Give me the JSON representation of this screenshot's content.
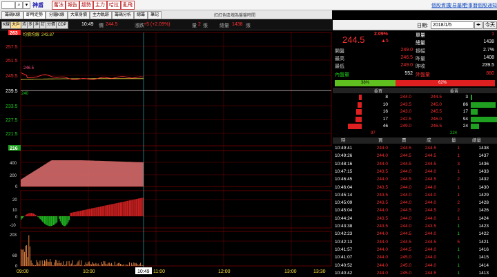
{
  "toolbar": {
    "stock_name": "神盾",
    "buttons": [
      "奮法",
      "報告",
      "趨勢",
      "主力",
      "哈拉",
      "亂飛"
    ],
    "links": [
      "個股資訊",
      "交易屬性",
      "行事曆",
      "個股通知"
    ]
  },
  "tabs": {
    "items": [
      "籌碼K線",
      "即時走勢",
      "分鐘K線",
      "大單身價",
      "主力軌跡",
      "籌碼分析",
      "總籌",
      "筆記"
    ],
    "active": 1,
    "notice": "紅紅色區塊為盤盤時間"
  },
  "kbar": {
    "buttons": [
      "K線",
      "大戶",
      "均",
      "多",
      "淨",
      "訂",
      "分價",
      "CDP"
    ],
    "time": "10:49",
    "price_label": "價",
    "price": "244.5",
    "change_label": "漲跌",
    "change": "+5 (+2.09%)",
    "vol_label": "量",
    "vol": "2",
    "vol_unit": "張",
    "total_label": "總量",
    "total": "1438",
    "total_unit": "張"
  },
  "chart": {
    "avg_label": "均價均線",
    "avg_value": "243.87",
    "price_top_tag": "263",
    "price_ticks": [
      "257.5",
      "251.5",
      "245.5",
      "239.5",
      "233.5",
      "227.5",
      "221.5"
    ],
    "ref_label": "240",
    "line_label": "246.5",
    "vol_tag": "216",
    "vol_ticks": [
      "400",
      "200",
      "0",
      "20",
      "10",
      "0",
      "-10",
      "203",
      "69",
      "0"
    ],
    "time_ticks": [
      "09:00",
      "10:00",
      "11:00",
      "12:00",
      "13:00",
      "13:30"
    ],
    "cursor_time": "10:49",
    "colors": {
      "price": "#ff3030",
      "avg": "#ffe040",
      "volume": "#e07070",
      "up": "#cc2020",
      "down": "#20b020",
      "grid": "#7a0000"
    }
  },
  "right": {
    "date_label": "日期:",
    "date": "2018/1/5",
    "today_label": "今天",
    "price": "244.5",
    "change_pct": "2.09%",
    "change": "▲5",
    "single_label": "單量",
    "single": "1",
    "total_label": "總量",
    "total": "1438",
    "stats": [
      {
        "l": "開盤",
        "v": "249.0",
        "l2": "振幅",
        "v2": "2.7%"
      },
      {
        "l": "最高",
        "v": "246.5",
        "l2": "昨量",
        "v2": "1408"
      },
      {
        "l": "最低",
        "v": "249.0",
        "l2": "昨收",
        "v2": "239.5"
      }
    ],
    "inner_label": "內盤量",
    "inner": "552",
    "outer_label": "外盤量",
    "outer": "880",
    "inner_pct": "38%",
    "outer_pct": "62%",
    "inner_frac": 0.38,
    "book_hdr_buy": "委買",
    "book_hdr_sell": "委賣",
    "book": [
      {
        "bq": "8",
        "bp": "244.0",
        "sp": "244.5",
        "sq": "3",
        "bw": 4,
        "sw": 2
      },
      {
        "bq": "10",
        "bp": "243.5",
        "sp": "245.0",
        "sq": "86",
        "bw": 6,
        "sw": 36
      },
      {
        "bq": "16",
        "bp": "243.0",
        "sp": "245.5",
        "sq": "17",
        "bw": 8,
        "sw": 10
      },
      {
        "bq": "17",
        "bp": "242.5",
        "sp": "246.0",
        "sq": "94",
        "bw": 9,
        "sw": 38
      },
      {
        "bq": "46",
        "bp": "249.0",
        "sp": "246.5",
        "sq": "24",
        "bw": 20,
        "sw": 12
      }
    ],
    "book_sum_buy": "97",
    "book_sum_sell": "224",
    "tick_hdr": [
      "時",
      "買",
      "賣",
      "成",
      "量",
      "總量"
    ],
    "ticks": [
      {
        "t": "10:49:41",
        "b": "244.0",
        "s": "244.5",
        "p": "244.5",
        "q": "1",
        "tot": "1438"
      },
      {
        "t": "10:49:26",
        "b": "244.0",
        "s": "244.5",
        "p": "244.5",
        "q": "1",
        "tot": "1437"
      },
      {
        "t": "10:48:16",
        "b": "244.0",
        "s": "244.5",
        "p": "244.5",
        "q": "3",
        "tot": "1436"
      },
      {
        "t": "10:47:15",
        "b": "243.5",
        "s": "244.0",
        "p": "244.0",
        "q": "1",
        "tot": "1433"
      },
      {
        "t": "10:46:45",
        "b": "244.0",
        "s": "244.5",
        "p": "244.5",
        "q": "2",
        "tot": "1432"
      },
      {
        "t": "10:46:04",
        "b": "243.5",
        "s": "244.0",
        "p": "244.0",
        "q": "1",
        "tot": "1430"
      },
      {
        "t": "10:45:14",
        "b": "243.5",
        "s": "244.0",
        "p": "244.0",
        "q": "1",
        "tot": "1429"
      },
      {
        "t": "10:45:09",
        "b": "243.5",
        "s": "244.0",
        "p": "244.0",
        "q": "2",
        "tot": "1428"
      },
      {
        "t": "10:45:04",
        "b": "244.0",
        "s": "244.5",
        "p": "244.5",
        "q": "2",
        "tot": "1426"
      },
      {
        "t": "10:44:24",
        "b": "243.5",
        "s": "244.0",
        "p": "244.0",
        "q": "1",
        "tot": "1424"
      },
      {
        "t": "10:43:38",
        "b": "243.5",
        "s": "244.0",
        "p": "243.5",
        "q": "1",
        "tot": "1423"
      },
      {
        "t": "10:42:23",
        "b": "244.0",
        "s": "244.5",
        "p": "244.0",
        "q": "1",
        "tot": "1422"
      },
      {
        "t": "10:42:13",
        "b": "244.0",
        "s": "244.5",
        "p": "244.5",
        "q": "5",
        "tot": "1421"
      },
      {
        "t": "10:41:57",
        "b": "244.0",
        "s": "244.5",
        "p": "244.0",
        "q": "1",
        "tot": "1416"
      },
      {
        "t": "10:41:07",
        "b": "244.0",
        "s": "245.0",
        "p": "244.0",
        "q": "1",
        "tot": "1415"
      },
      {
        "t": "10:40:52",
        "b": "244.0",
        "s": "245.0",
        "p": "244.0",
        "q": "1",
        "tot": "1414"
      },
      {
        "t": "10:40:42",
        "b": "244.0",
        "s": "245.0",
        "p": "244.5",
        "q": "1",
        "tot": "1413"
      }
    ]
  }
}
